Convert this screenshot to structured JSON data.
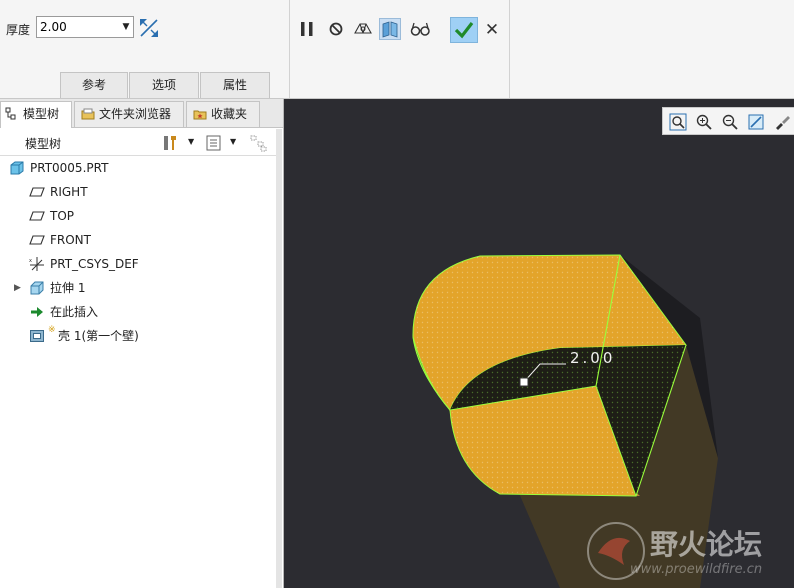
{
  "dashboard": {
    "thickness_label": "厚度",
    "thickness_value": "2.00",
    "panels": [
      "参考",
      "选项",
      "属性"
    ]
  },
  "left_panel": {
    "tabs": [
      {
        "label": "模型树",
        "icon": "model-tree-icon"
      },
      {
        "label": "文件夹浏览器",
        "icon": "folder-browser-icon"
      },
      {
        "label": "收藏夹",
        "icon": "favorites-icon"
      }
    ],
    "tree_title": "模型树",
    "tree_items": [
      {
        "label": "PRT0005.PRT",
        "icon": "part-icon"
      },
      {
        "label": "RIGHT",
        "icon": "datum-plane-icon"
      },
      {
        "label": "TOP",
        "icon": "datum-plane-icon"
      },
      {
        "label": "FRONT",
        "icon": "datum-plane-icon"
      },
      {
        "label": "PRT_CSYS_DEF",
        "icon": "csys-icon"
      },
      {
        "label": "拉伸 1",
        "icon": "extrude-icon"
      },
      {
        "label": "在此插入",
        "icon": "insert-here-arrow-icon"
      },
      {
        "label": "壳 1(第一个壁)",
        "icon": "shell-icon"
      }
    ]
  },
  "viewport": {
    "dimension_value": "2.00",
    "watermark_cn": "野火论坛",
    "watermark_url": "www.proewildfire.cn",
    "colors": {
      "background": "#2c2c31",
      "part": "#e3a42a",
      "edge": "#9aff3c"
    }
  }
}
